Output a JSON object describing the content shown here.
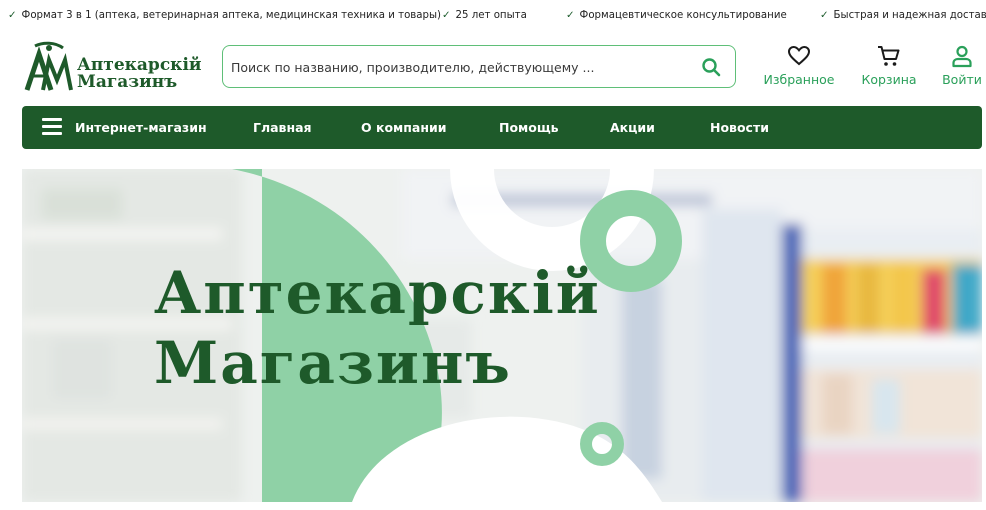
{
  "features": [
    "Формат 3 в 1 (аптека, ветеринарная аптека, медицинская техника и товары)",
    "25 лет опыта",
    "Формацевтическое консультирование",
    "Быстрая и надежная доставка"
  ],
  "check_glyph": "✓",
  "logo": {
    "line1": "Аптекарскій",
    "line2": "Магазинъ"
  },
  "search": {
    "placeholder": "Поиск по названию, производителю, действующему ..."
  },
  "header_actions": {
    "favorites": "Избранное",
    "cart": "Корзина",
    "login": "Войти"
  },
  "nav": {
    "catalog": "Интернет-магазин",
    "items": [
      "Главная",
      "О компании",
      "Помощь",
      "Акции",
      "Новости"
    ]
  },
  "hero": {
    "title_line1": "Аптекарскій",
    "title_line2": "Магазинъ"
  },
  "colors": {
    "brand_dark": "#1e5a2a",
    "accent_green": "#2aa05a",
    "mint": "#8fd1a6"
  },
  "icons": [
    "search-icon",
    "heart-icon",
    "cart-icon",
    "user-icon",
    "menu-icon"
  ]
}
